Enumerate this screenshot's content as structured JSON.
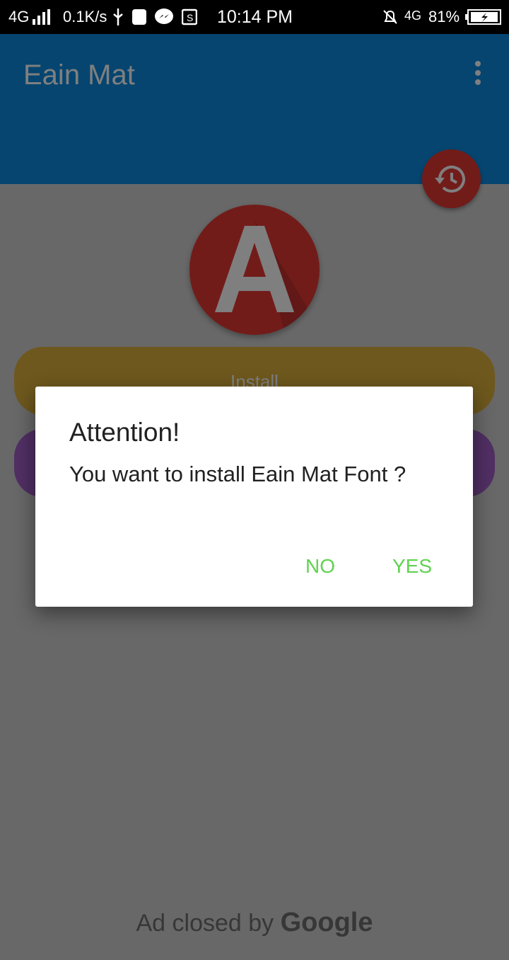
{
  "status_bar": {
    "network": "4G",
    "speed": "0.1K/s",
    "time": "10:14 PM",
    "network_right": "4G",
    "battery": "81%"
  },
  "app_bar": {
    "title": "Eain Mat"
  },
  "main": {
    "install_label": "Install"
  },
  "dialog": {
    "title": "Attention!",
    "message": "You want to install Eain Mat Font ?",
    "no_label": "NO",
    "yes_label": "YES"
  },
  "ad": {
    "prefix": "Ad closed by",
    "brand": "Google"
  },
  "colors": {
    "app_bar": "#0a8be0",
    "fab": "#e53935",
    "install_button": "#dcb03a",
    "second_button": "#a35fc9",
    "dialog_action": "#5fd34f"
  },
  "icons": [
    "signal-icon",
    "usb-icon",
    "messenger-icon",
    "mute-bell-icon",
    "battery-icon",
    "history-icon",
    "overflow-menu-icon"
  ]
}
